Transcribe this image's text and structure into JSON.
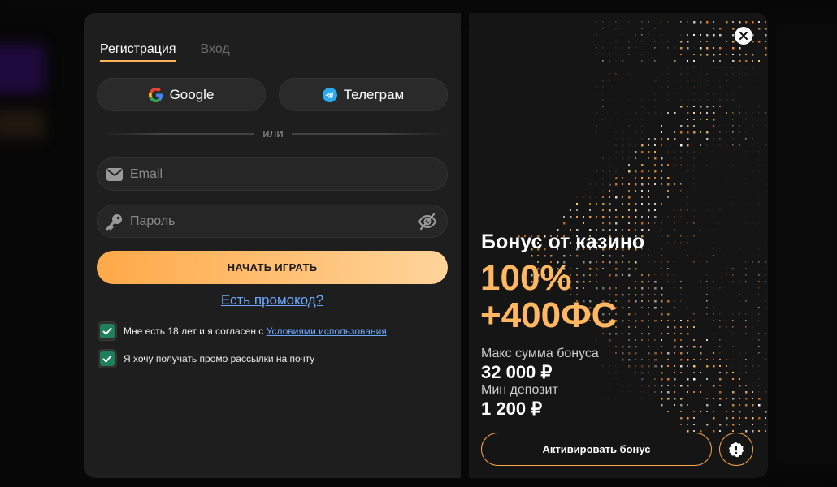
{
  "tabs": {
    "register": "Регистрация",
    "login": "Вход"
  },
  "social": {
    "google": "Google",
    "telegram": "Телеграм"
  },
  "divider_text": "или",
  "fields": {
    "email": {
      "placeholder": "Email",
      "value": ""
    },
    "password": {
      "placeholder": "Пароль",
      "value": ""
    }
  },
  "cta_label": "НАЧАТЬ ИГРАТЬ",
  "promo_link": "Есть промокод?",
  "consent": {
    "age_text": "Мне есть 18 лет и я согласен с ",
    "terms_link": "Условиями использования",
    "age_checked": true,
    "newsletter_text": "Я хочу получать промо рассылки на почту",
    "newsletter_checked": true
  },
  "bonus": {
    "title": "Бонус от казино",
    "amount_line1": "100%",
    "amount_line2": "+400ФС",
    "max_label": "Макс сумма бонуса",
    "max_value": "32 000 ₽",
    "min_label": "Мин депозит",
    "min_value": "1 200 ₽",
    "activate_label": "Активировать бонус"
  },
  "colors": {
    "accent": "#ffa948",
    "link": "#6aa8ff",
    "check": "#1f7f5a",
    "panel": "#1e1e1e"
  },
  "icons": [
    "google-icon",
    "telegram-icon",
    "mail-icon",
    "key-icon",
    "eye-off-icon",
    "check-icon",
    "close-icon",
    "alert-icon"
  ]
}
